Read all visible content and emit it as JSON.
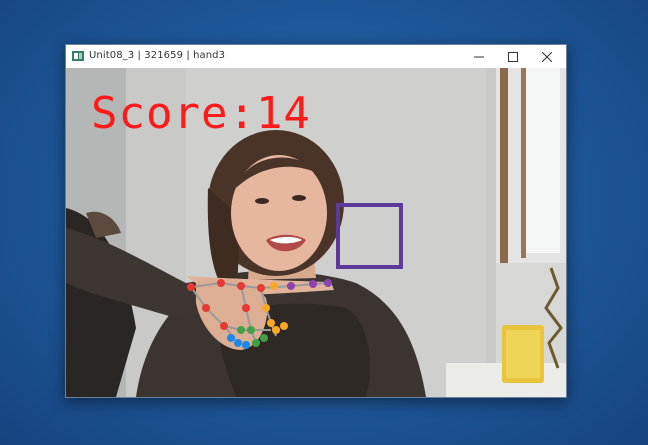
{
  "window": {
    "title": "Unit08_3 | 321659 | hand3",
    "controls": {
      "minimize": "minimize-icon",
      "maximize": "maximize-icon",
      "close": "close-icon"
    }
  },
  "camera": {
    "score_text": "Score:14",
    "target_color": "#5b3a99",
    "score_color": "#ff1a1a"
  }
}
